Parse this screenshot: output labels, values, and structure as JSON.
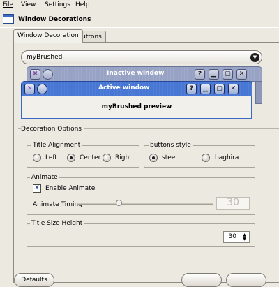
{
  "menubar": {
    "file": "File",
    "view": "View",
    "settings": "Settings",
    "help": "Help"
  },
  "header": {
    "title": "Window Decorations"
  },
  "tabs": [
    {
      "label": "Window Decoration",
      "active": true
    },
    {
      "label": "Buttons",
      "active": false
    }
  ],
  "decoration_select": {
    "value": "myBrushed"
  },
  "preview": {
    "inactive_title": "Inactive window",
    "active_title": "Active window",
    "body_text": "myBrushed preview",
    "buttons": {
      "help": "?",
      "close": "✕"
    }
  },
  "options": {
    "section_label": "Decoration Options",
    "title_alignment": {
      "label": "Title Alignment",
      "options": [
        "Left",
        "Center",
        "Right"
      ],
      "selected": "Center"
    },
    "buttons_style": {
      "label": "buttons style",
      "options": [
        "steel",
        "baghira"
      ],
      "selected": "steel"
    },
    "animate": {
      "label": "Animate",
      "enable_label": "Enable Animate",
      "enabled": true,
      "timing_label": "Animate Timing",
      "timing_value_fraction": 0.3
    },
    "title_size": {
      "label": "Title Size Height",
      "value": "30"
    }
  },
  "footer": {
    "defaults": "Defaults"
  },
  "colors": {
    "active_title": "#4a78d4",
    "inactive_title": "#9aa5c6",
    "window_bg": "#ece9e1"
  }
}
